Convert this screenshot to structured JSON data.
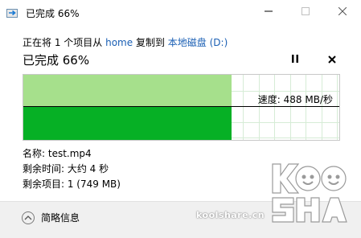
{
  "window": {
    "title": "已完成 66%",
    "controls": {
      "minimize_icon": "minimize-icon",
      "maximize_icon": "maximize-icon",
      "close_icon": "close-icon"
    }
  },
  "status": {
    "prefix": "正在将 1 个项目从",
    "source": "home",
    "middle": "复制到",
    "destination": "本地磁盘 (D:)"
  },
  "headline": "已完成 66%",
  "progress": {
    "fraction": 0.66,
    "pause_icon": "pause-icon",
    "cancel_icon": "close-icon"
  },
  "speed": {
    "label": "速度: 488 MB/秒"
  },
  "colors": {
    "graph_fill_light": "#a6e08c",
    "graph_fill_dark": "#06b025",
    "link": "#1a5fb4"
  },
  "details": {
    "name": "名称: test.mp4",
    "time_remaining": "剩余时间: 大约 4 秒",
    "items_remaining": "剩余项目: 1 (749 MB)"
  },
  "footer": {
    "toggle_label": "简略信息",
    "toggle_icon": "chevron-up-icon"
  },
  "watermark": {
    "site": "koolshare.cn"
  }
}
